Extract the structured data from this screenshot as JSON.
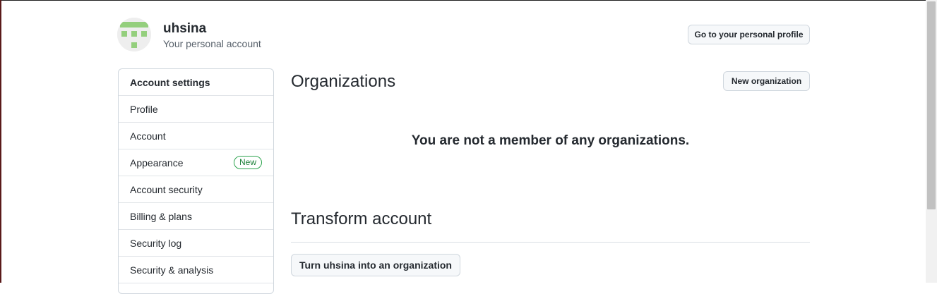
{
  "header": {
    "username": "uhsina",
    "subtitle": "Your personal account",
    "profile_button": "Go to your personal profile",
    "avatar_icon": "identicon-avatar"
  },
  "sidebar": {
    "title": "Account settings",
    "items": [
      {
        "label": "Profile"
      },
      {
        "label": "Account"
      },
      {
        "label": "Appearance",
        "badge": "New"
      },
      {
        "label": "Account security"
      },
      {
        "label": "Billing & plans"
      },
      {
        "label": "Security log"
      },
      {
        "label": "Security & analysis"
      }
    ]
  },
  "main": {
    "organizations_title": "Organizations",
    "new_org_button": "New organization",
    "empty_message": "You are not a member of any organizations.",
    "transform_title": "Transform account",
    "transform_button": "Turn uhsina into an organization"
  },
  "colors": {
    "identicon": "#94cf7d",
    "badge_green": "#1a7f37"
  }
}
